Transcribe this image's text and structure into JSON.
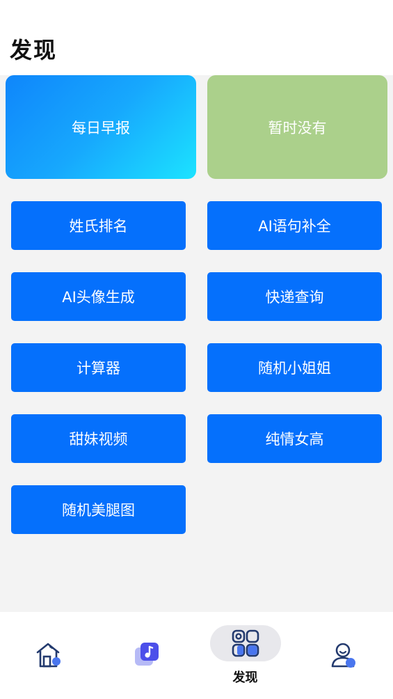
{
  "header": {
    "title": "发现"
  },
  "cards": {
    "daily_report": "每日早报",
    "nothing_yet": "暂时没有"
  },
  "tools": [
    "姓氏排名",
    "AI语句补全",
    "AI头像生成",
    "快递查询",
    "计算器",
    "随机小姐姐",
    "甜妹视频",
    "纯情女高",
    "随机美腿图"
  ],
  "tabbar": {
    "items": [
      {
        "name": "home",
        "icon": "home-icon",
        "label": ""
      },
      {
        "name": "music",
        "icon": "music-icon",
        "label": ""
      },
      {
        "name": "discover",
        "icon": "grid-icon",
        "label": "发现",
        "active": true
      },
      {
        "name": "profile",
        "icon": "user-icon",
        "label": ""
      }
    ]
  },
  "colors": {
    "primary_blue": "#0570fc",
    "card_gradient_start": "#0f86fb",
    "card_gradient_end": "#1ce3ff",
    "card_green": "#abd08b",
    "content_background": "#f3f3f3",
    "icon_navy": "#233a6e",
    "icon_accent": "#4a76ee"
  }
}
